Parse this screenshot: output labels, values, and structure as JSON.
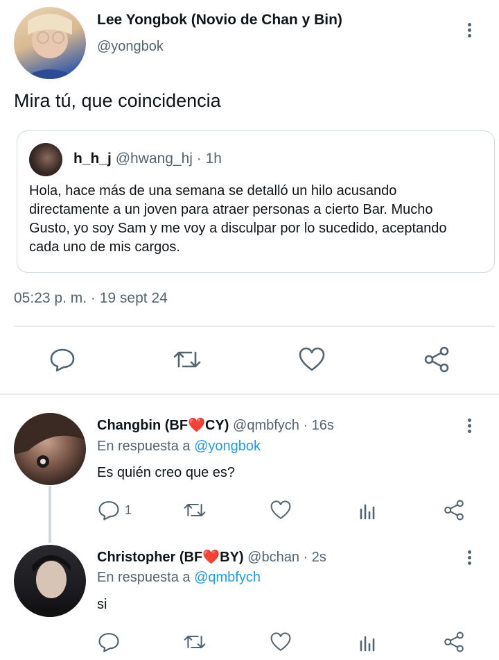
{
  "main_tweet": {
    "author_name": "Lee Yongbok (Novio de Chan y Bin)",
    "handle": "@yongbok",
    "text": "Mira tú, que coincidencia",
    "quote": {
      "author_name": "h_h_j",
      "handle_time": "@hwang_hj · 1h",
      "text": "Hola, hace más de una semana se detalló un hilo acusando directamente a un joven para atraer personas a cierto Bar. Mucho Gusto, yo soy Sam y me voy a disculpar por lo sucedido, aceptando cada uno de mis cargos."
    },
    "timestamp": "05:23 p. m. · 19 sept 24"
  },
  "replies": [
    {
      "author_name_prefix": "Changbin (BF",
      "heart": "❤️",
      "author_name_suffix": "CY)",
      "handle_time": "@qmbfych · 16s",
      "reply_prefix": "En respuesta a",
      "reply_to": "@yongbok",
      "text": "Es quién creo que es?",
      "reply_count": "1"
    },
    {
      "author_name_prefix": "Christopher (BF",
      "heart": "❤️",
      "author_name_suffix": "BY)",
      "handle_time": "@bchan · 2s",
      "reply_prefix": "En respuesta a",
      "reply_to": "@qmbfych",
      "text": "si",
      "reply_count": ""
    }
  ],
  "colors": {
    "accent": "#1d9bf0",
    "muted": "#536471",
    "heart": "#e0245e",
    "divider": "#e6ecf0"
  }
}
